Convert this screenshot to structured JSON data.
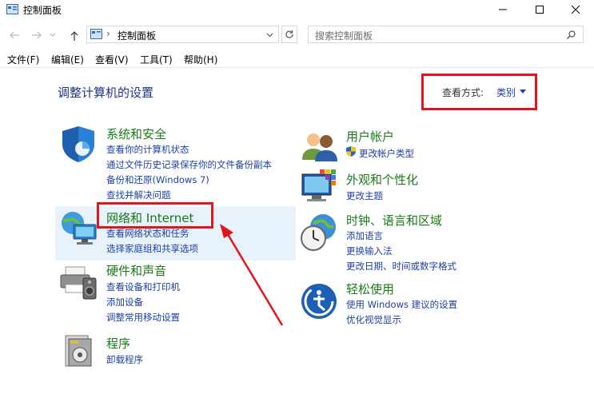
{
  "window": {
    "title": "控制面板",
    "controls": [
      "minimize",
      "maximize",
      "close"
    ]
  },
  "address_bar": {
    "separator": "›",
    "path": "控制面板",
    "search_placeholder": "搜索控制面板"
  },
  "menu": [
    "文件(F)",
    "编辑(E)",
    "查看(V)",
    "工具(T)",
    "帮助(H)"
  ],
  "main": {
    "heading": "调整计算机的设置",
    "view_by": {
      "label": "查看方式:",
      "value": "类别"
    }
  },
  "categories": [
    {
      "title": "系统和安全",
      "icon": "shield-icon",
      "links": [
        "查看你的计算机状态",
        "通过文件历史记录保存你的文件备份副本",
        "备份和还原(Windows 7)",
        "查找并解决问题"
      ]
    },
    {
      "title": "网络和 Internet",
      "icon": "network-globe-icon",
      "links": [
        "查看网络状态和任务",
        "选择家庭组和共享选项"
      ]
    },
    {
      "title": "硬件和声音",
      "icon": "printer-icon",
      "links": [
        "查看设备和打印机",
        "添加设备",
        "调整常用移动设置"
      ]
    },
    {
      "title": "程序",
      "icon": "programs-icon",
      "links": [
        "卸载程序"
      ]
    },
    {
      "title": "用户帐户",
      "icon": "users-icon",
      "links": [
        "更改帐户类型"
      ]
    },
    {
      "title": "外观和个性化",
      "icon": "monitor-palette-icon",
      "links": [
        "更改主题"
      ]
    },
    {
      "title": "时钟、语言和区域",
      "icon": "clock-globe-icon",
      "links": [
        "添加语言",
        "更换输入法",
        "更改日期、时间或数字格式"
      ]
    },
    {
      "title": "轻松使用",
      "icon": "ease-of-access-icon",
      "links": [
        "使用 Windows 建议的设置",
        "优化视觉显示"
      ]
    }
  ],
  "colors": {
    "category_title": "#1a7a1a",
    "link": "#1e3fa0",
    "heading": "#1e3287",
    "highlight_annotation": "#e4141c",
    "hover_background": "#e7f2fb"
  }
}
